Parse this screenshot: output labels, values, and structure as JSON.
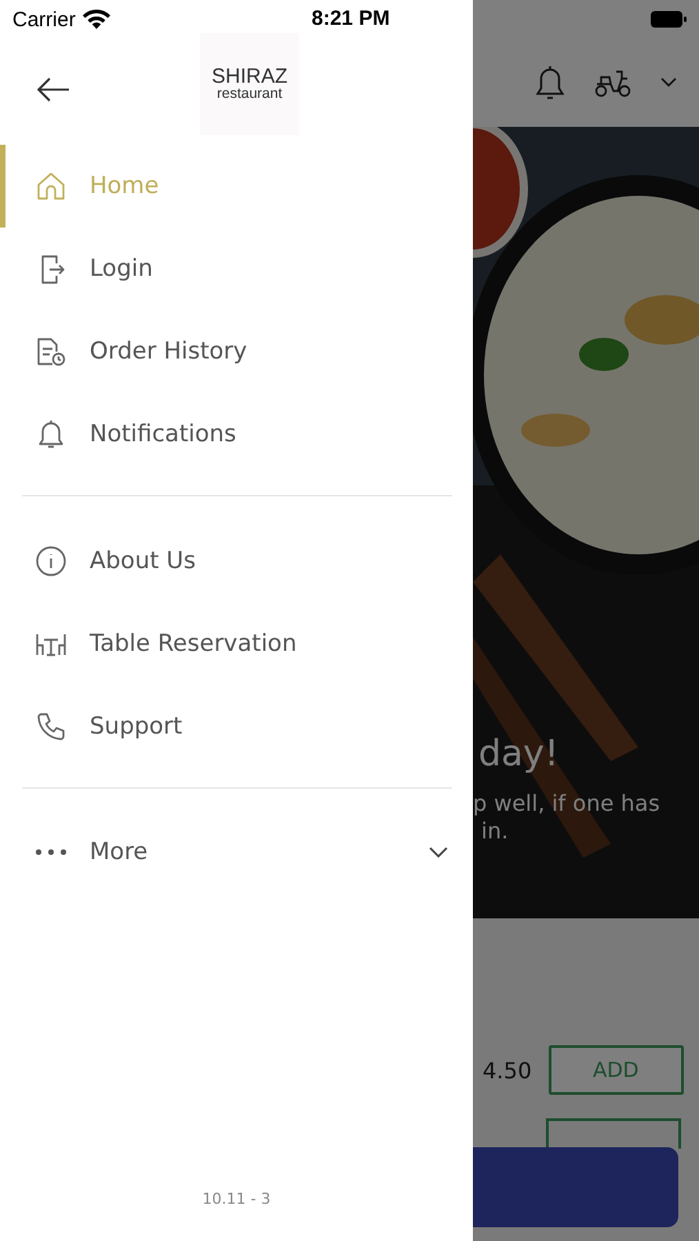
{
  "status_bar": {
    "carrier": "Carrier",
    "time": "8:21 PM"
  },
  "drawer": {
    "logo": {
      "title": "SHIRAZ",
      "subtitle": "restaurant"
    },
    "sections": [
      {
        "items": [
          {
            "label": "Home",
            "kind": "home",
            "selected": true
          },
          {
            "label": "Login",
            "kind": "login",
            "selected": false
          },
          {
            "label": "Order History",
            "kind": "history",
            "selected": false
          },
          {
            "label": "Notifications",
            "kind": "bell",
            "selected": false
          }
        ]
      },
      {
        "items": [
          {
            "label": "About Us",
            "kind": "info",
            "selected": false
          },
          {
            "label": "Table Reservation",
            "kind": "table",
            "selected": false
          },
          {
            "label": "Support",
            "kind": "phone",
            "selected": false
          }
        ]
      }
    ],
    "more": {
      "label": "More",
      "expanded": false
    },
    "version": "10.11 - 3"
  },
  "background": {
    "banner": {
      "heading": "day!",
      "lines": [
        "p well, if one has",
        "in."
      ]
    },
    "product": {
      "price": "4.50",
      "button": "ADD"
    }
  }
}
